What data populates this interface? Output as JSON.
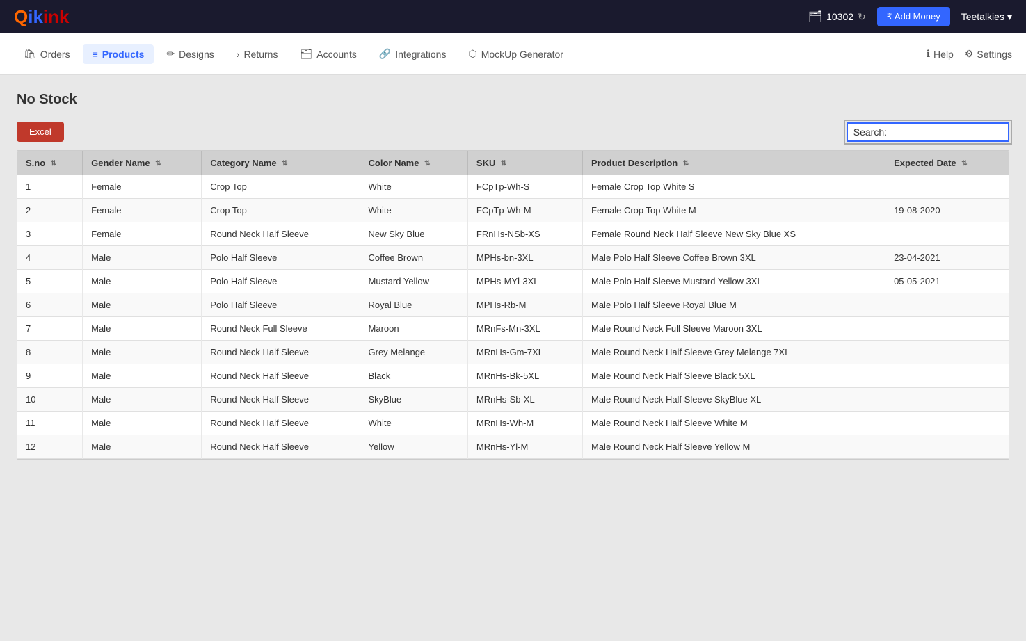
{
  "topbar": {
    "logo": {
      "q": "Q",
      "ik": "ik",
      "ink": "ink"
    },
    "balance": "10302",
    "balance_icon": "🗂",
    "add_money_label": "₹ Add Money",
    "user": "Teetalkies",
    "dropdown_icon": "▾"
  },
  "nav": {
    "items": [
      {
        "label": "Orders",
        "icon": "🛍",
        "active": false
      },
      {
        "label": "Products",
        "icon": "≡",
        "active": true
      },
      {
        "label": "Designs",
        "icon": "✏",
        "active": false
      },
      {
        "label": "Returns",
        "icon": "›",
        "active": false
      },
      {
        "label": "Accounts",
        "icon": "🗂",
        "active": false
      },
      {
        "label": "Integrations",
        "icon": "🔗",
        "active": false
      },
      {
        "label": "MockUp Generator",
        "icon": "⬡",
        "active": false
      }
    ],
    "right_items": [
      {
        "label": "Help",
        "icon": "ℹ"
      },
      {
        "label": "Settings",
        "icon": "⚙"
      }
    ]
  },
  "page": {
    "title": "No Stock",
    "excel_label": "Excel",
    "search_label": "Search:",
    "search_placeholder": ""
  },
  "table": {
    "columns": [
      {
        "label": "S.no",
        "sortable": true
      },
      {
        "label": "Gender Name",
        "sortable": true
      },
      {
        "label": "Category Name",
        "sortable": true
      },
      {
        "label": "Color Name",
        "sortable": true
      },
      {
        "label": "SKU",
        "sortable": true
      },
      {
        "label": "Product Description",
        "sortable": true
      },
      {
        "label": "Expected Date",
        "sortable": true
      }
    ],
    "rows": [
      {
        "sno": "1",
        "gender": "Female",
        "category": "Crop Top",
        "color": "White",
        "sku": "FCpTp-Wh-S",
        "description": "Female Crop Top White S",
        "date": ""
      },
      {
        "sno": "2",
        "gender": "Female",
        "category": "Crop Top",
        "color": "White",
        "sku": "FCpTp-Wh-M",
        "description": "Female Crop Top White M",
        "date": "19-08-2020"
      },
      {
        "sno": "3",
        "gender": "Female",
        "category": "Round Neck Half Sleeve",
        "color": "New Sky Blue",
        "sku": "FRnHs-NSb-XS",
        "description": "Female Round Neck Half Sleeve New Sky Blue XS",
        "date": ""
      },
      {
        "sno": "4",
        "gender": "Male",
        "category": "Polo Half Sleeve",
        "color": "Coffee Brown",
        "sku": "MPHs-bn-3XL",
        "description": "Male Polo Half Sleeve Coffee Brown 3XL",
        "date": "23-04-2021"
      },
      {
        "sno": "5",
        "gender": "Male",
        "category": "Polo Half Sleeve",
        "color": "Mustard Yellow",
        "sku": "MPHs-MYl-3XL",
        "description": "Male Polo Half Sleeve Mustard Yellow 3XL",
        "date": "05-05-2021"
      },
      {
        "sno": "6",
        "gender": "Male",
        "category": "Polo Half Sleeve",
        "color": "Royal Blue",
        "sku": "MPHs-Rb-M",
        "description": "Male Polo Half Sleeve Royal Blue M",
        "date": ""
      },
      {
        "sno": "7",
        "gender": "Male",
        "category": "Round Neck Full Sleeve",
        "color": "Maroon",
        "sku": "MRnFs-Mn-3XL",
        "description": "Male Round Neck Full Sleeve Maroon 3XL",
        "date": ""
      },
      {
        "sno": "8",
        "gender": "Male",
        "category": "Round Neck Half Sleeve",
        "color": "Grey Melange",
        "sku": "MRnHs-Gm-7XL",
        "description": "Male Round Neck Half Sleeve Grey Melange 7XL",
        "date": ""
      },
      {
        "sno": "9",
        "gender": "Male",
        "category": "Round Neck Half Sleeve",
        "color": "Black",
        "sku": "MRnHs-Bk-5XL",
        "description": "Male Round Neck Half Sleeve Black 5XL",
        "date": ""
      },
      {
        "sno": "10",
        "gender": "Male",
        "category": "Round Neck Half Sleeve",
        "color": "SkyBlue",
        "sku": "MRnHs-Sb-XL",
        "description": "Male Round Neck Half Sleeve SkyBlue XL",
        "date": ""
      },
      {
        "sno": "11",
        "gender": "Male",
        "category": "Round Neck Half Sleeve",
        "color": "White",
        "sku": "MRnHs-Wh-M",
        "description": "Male Round Neck Half Sleeve White M",
        "date": ""
      },
      {
        "sno": "12",
        "gender": "Male",
        "category": "Round Neck Half Sleeve",
        "color": "Yellow",
        "sku": "MRnHs-Yl-M",
        "description": "Male Round Neck Half Sleeve Yellow M",
        "date": ""
      }
    ]
  }
}
